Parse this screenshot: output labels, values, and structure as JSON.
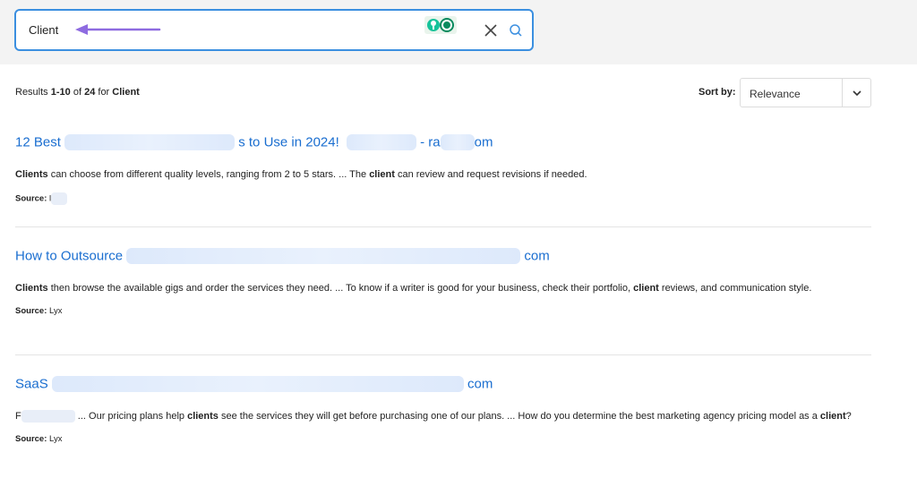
{
  "search": {
    "query": "Client"
  },
  "results_info": {
    "prefix": "Results ",
    "range": "1-10",
    "of": " of ",
    "total": "24",
    "for": " for ",
    "term": "Client"
  },
  "sort": {
    "label": "Sort by:",
    "value": "Relevance"
  },
  "results": [
    {
      "title_start": "12 Best",
      "title_mid": "s to Use in 2024!",
      "title_dash": "- ra",
      "title_end": "om",
      "snippet": [
        {
          "b": "Clients"
        },
        {
          "t": " can choose from different quality levels, ranging from 2 to 5 stars. ... The "
        },
        {
          "b": "client"
        },
        {
          "t": " can review and request revisions if needed."
        }
      ],
      "source_label": "Source:",
      "source_value": "l"
    },
    {
      "title_start": "How to Outsource",
      "title_end": "com",
      "snippet": [
        {
          "b": "Clients"
        },
        {
          "t": " then browse the available gigs and order the services they need. ... To know if a writer is good for your business, check their portfolio, "
        },
        {
          "b": "client"
        },
        {
          "t": " reviews, and communication style."
        }
      ],
      "source_label": "Source:",
      "source_value": "Lyx"
    },
    {
      "title_start": "SaaS",
      "title_end": "com",
      "snippet": [
        {
          "t": "F"
        },
        {
          "t": " ... Our pricing plans help "
        },
        {
          "b": "clients"
        },
        {
          "t": " see the services they will get before purchasing one of our plans. ... How do you determine the best marketing agency pricing model as a "
        },
        {
          "b": "client"
        },
        {
          "t": "?"
        }
      ],
      "source_label": "Source:",
      "source_value": "Lyx"
    }
  ],
  "colors": {
    "link": "#1a6ed0",
    "focus_border": "#3b8fe0",
    "arrow": "#8e6be0",
    "topbar": "#f3f3f3"
  },
  "icons": [
    "arrow-left-icon",
    "grammar-extension-icon",
    "close-icon",
    "search-icon",
    "chevron-down-icon"
  ]
}
